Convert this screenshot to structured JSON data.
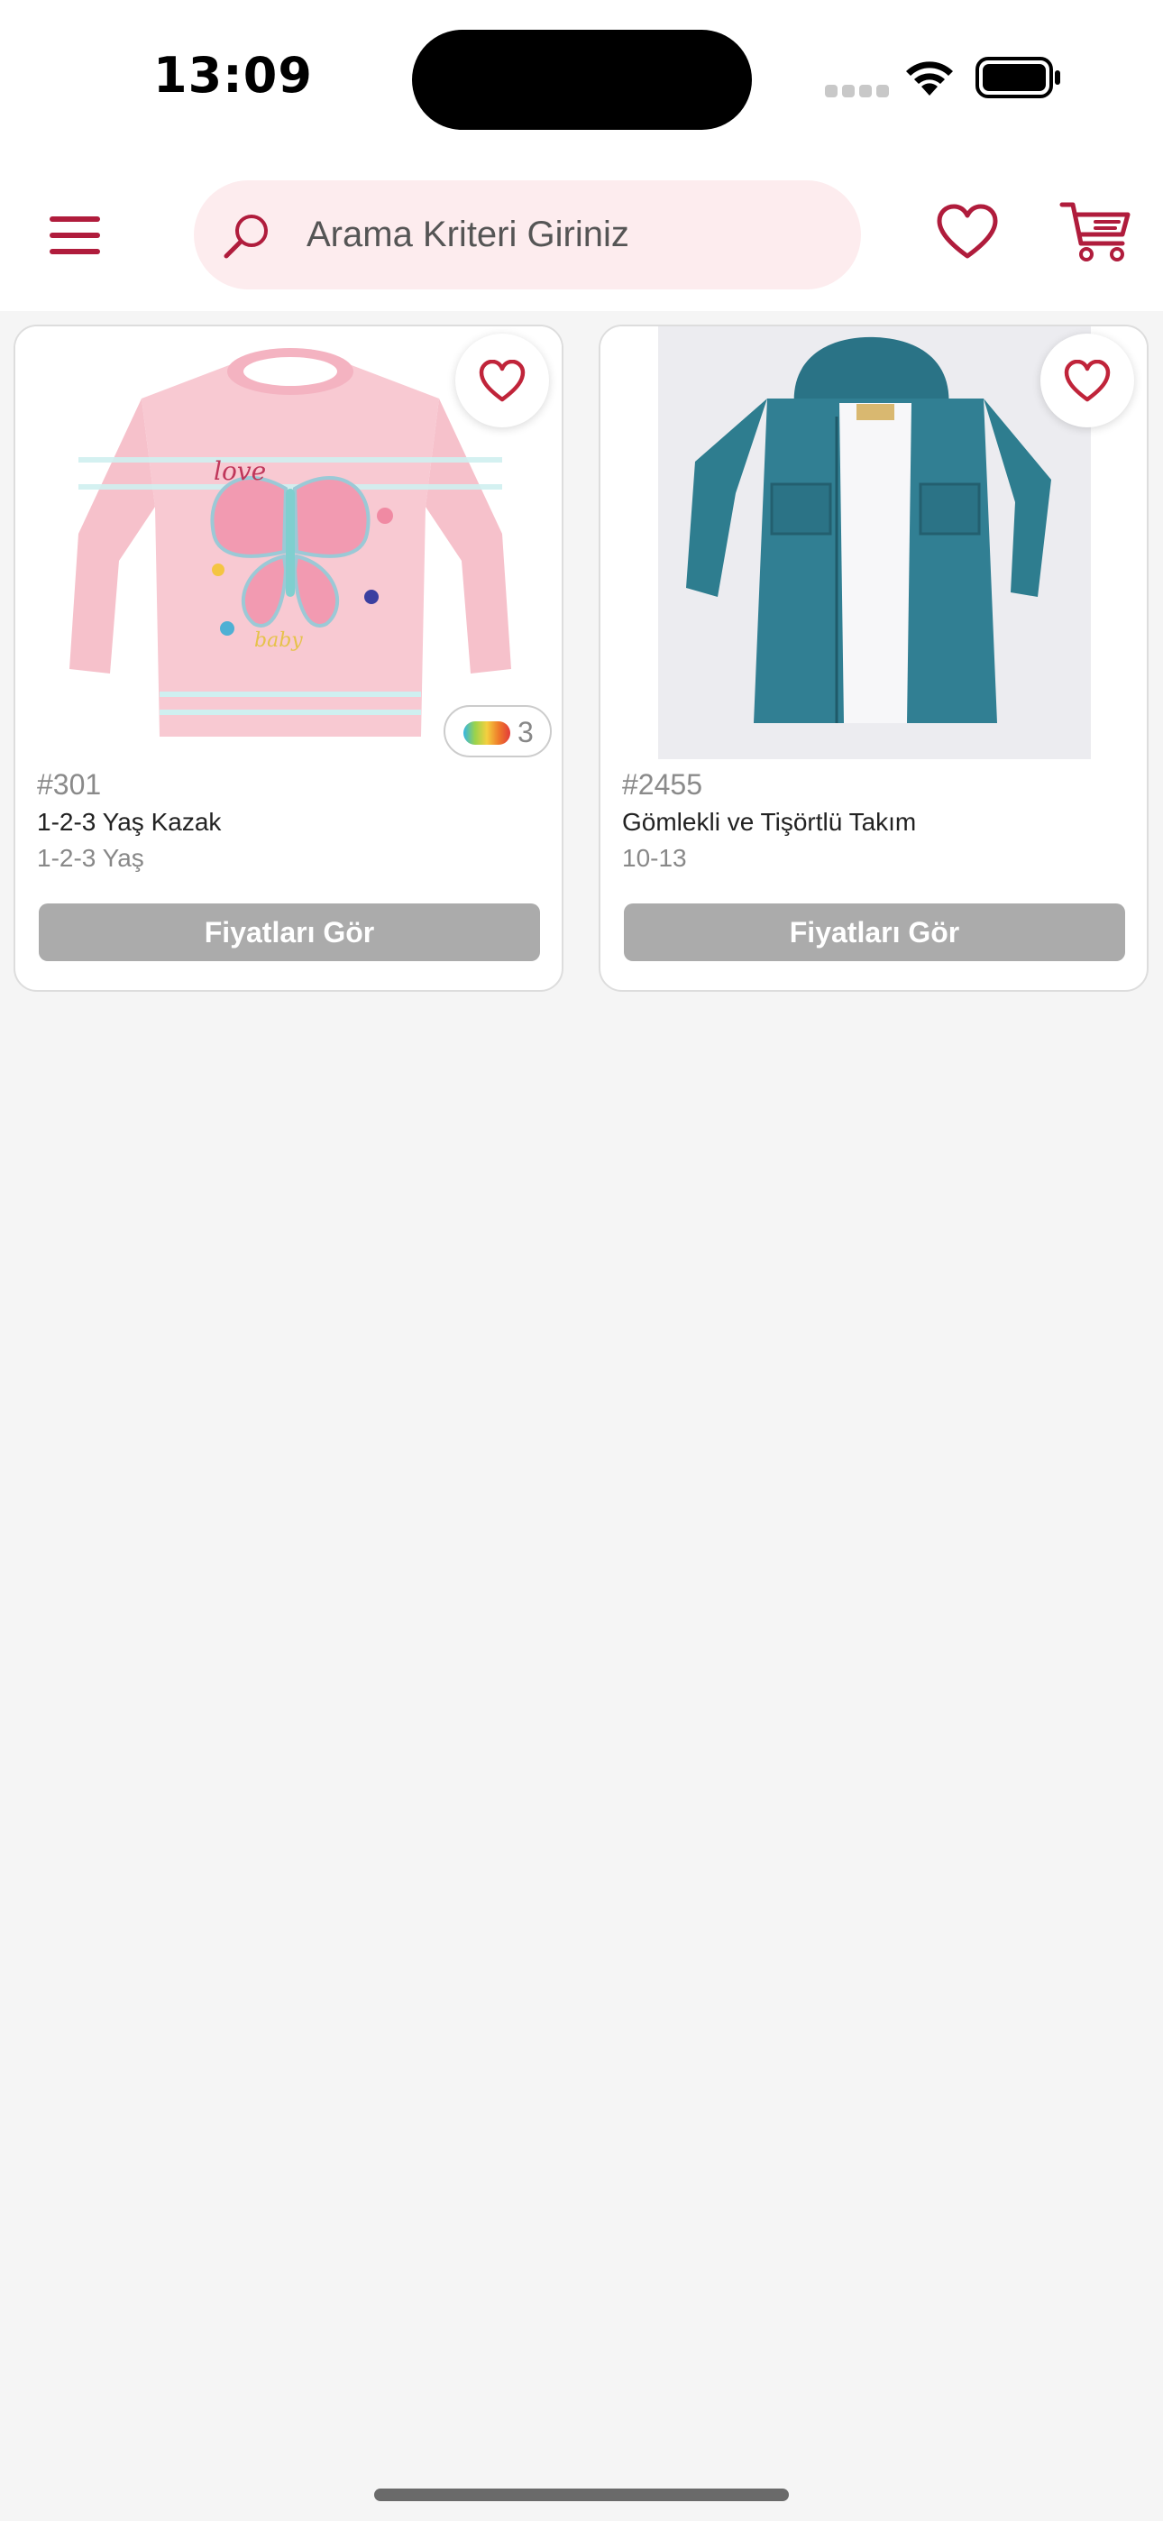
{
  "status_bar": {
    "time": "13:09"
  },
  "search": {
    "placeholder": "Arama Kriteri Giriniz"
  },
  "products": [
    {
      "sku": "#301",
      "name": "1-2-3 Yaş Kazak",
      "size": "1-2-3 Yaş",
      "color_count": "3",
      "button_label": "Fiyatları Gör",
      "image": "pink-sweater-butterfly"
    },
    {
      "sku": "#2455",
      "name": "Gömlekli ve Tişörtlü Takım",
      "size": "10-13",
      "button_label": "Fiyatları Gör",
      "image": "teal-hooded-shirt-set"
    }
  ],
  "colors": {
    "accent": "#b01c3c",
    "search_bg": "#fdecee",
    "button_disabled": "#ababab",
    "page_bg": "#f5f5f5"
  },
  "icons": [
    "menu-icon",
    "search-icon",
    "heart-icon",
    "cart-icon",
    "wifi-icon",
    "battery-icon",
    "signal-icon"
  ]
}
